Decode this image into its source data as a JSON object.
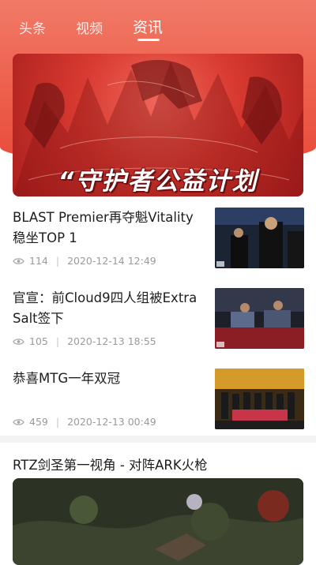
{
  "tabs": [
    {
      "label": "头条",
      "active": false
    },
    {
      "label": "视频",
      "active": false
    },
    {
      "label": "资讯",
      "active": true
    }
  ],
  "banner": {
    "title": "“守护者公益计划"
  },
  "news": [
    {
      "title": "BLAST Premier再夺魁Vitality稳坐TOP 1",
      "views": "114",
      "date": "2020-12-14 12:49",
      "thumb_icon": "esports-player-photo"
    },
    {
      "title": "官宣：前Cloud9四人组被Extra Salt签下",
      "views": "105",
      "date": "2020-12-13 18:55",
      "thumb_icon": "esports-stage-photo"
    },
    {
      "title": "恭喜MTG一年双冠",
      "views": "459",
      "date": "2020-12-13 00:49",
      "thumb_icon": "esports-team-photo"
    }
  ],
  "video": {
    "title": "RTZ剑圣第一视角 - 对阵ARK火枪"
  },
  "colors": {
    "accent": "#ee5f4c",
    "meta": "#9a9a9a"
  }
}
